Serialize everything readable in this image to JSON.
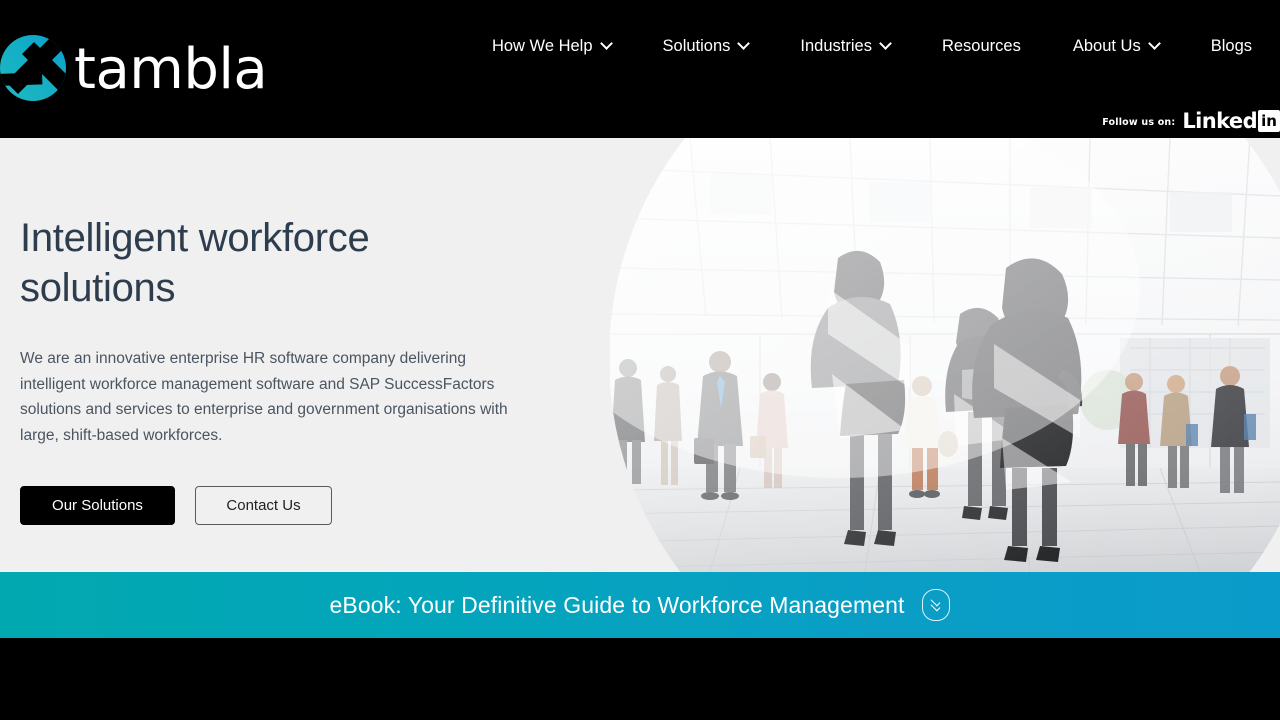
{
  "brand": {
    "wordmark": "tambla",
    "logo_colors": {
      "gradient_from": "#2bbfc4",
      "gradient_to": "#0a9fc9",
      "mark": "#000000"
    }
  },
  "header": {
    "background": "#000000",
    "nav": [
      {
        "label": "How We Help",
        "has_dropdown": true
      },
      {
        "label": "Solutions",
        "has_dropdown": true
      },
      {
        "label": "Industries",
        "has_dropdown": true
      },
      {
        "label": "Resources",
        "has_dropdown": false
      },
      {
        "label": "About Us",
        "has_dropdown": true
      },
      {
        "label": "Blogs",
        "has_dropdown": false
      }
    ],
    "follow": {
      "label": "Follow us on:",
      "network_word": "Linked",
      "network_badge": "in"
    }
  },
  "hero": {
    "background": "#f0f0f0",
    "title": "Intelligent workforce solutions",
    "paragraph": "We are an innovative enterprise HR software company delivering intelligent workforce management software and SAP SuccessFactors solutions and services to enterprise and government organisations with large, shift-based workforces.",
    "title_color": "#2e3d4d",
    "buttons": [
      {
        "label": "Our Solutions",
        "style": "primary"
      },
      {
        "label": "Contact Us",
        "style": "secondary"
      }
    ],
    "image_alt": "Business people walking in a bright glass atrium"
  },
  "ebook_banner": {
    "text": "eBook: Your Definitive Guide to Workforce Management",
    "toggle_icon": "double-chevron-down-icon",
    "gradient_from": "#02a8b0",
    "gradient_to": "#0b9bcb"
  }
}
